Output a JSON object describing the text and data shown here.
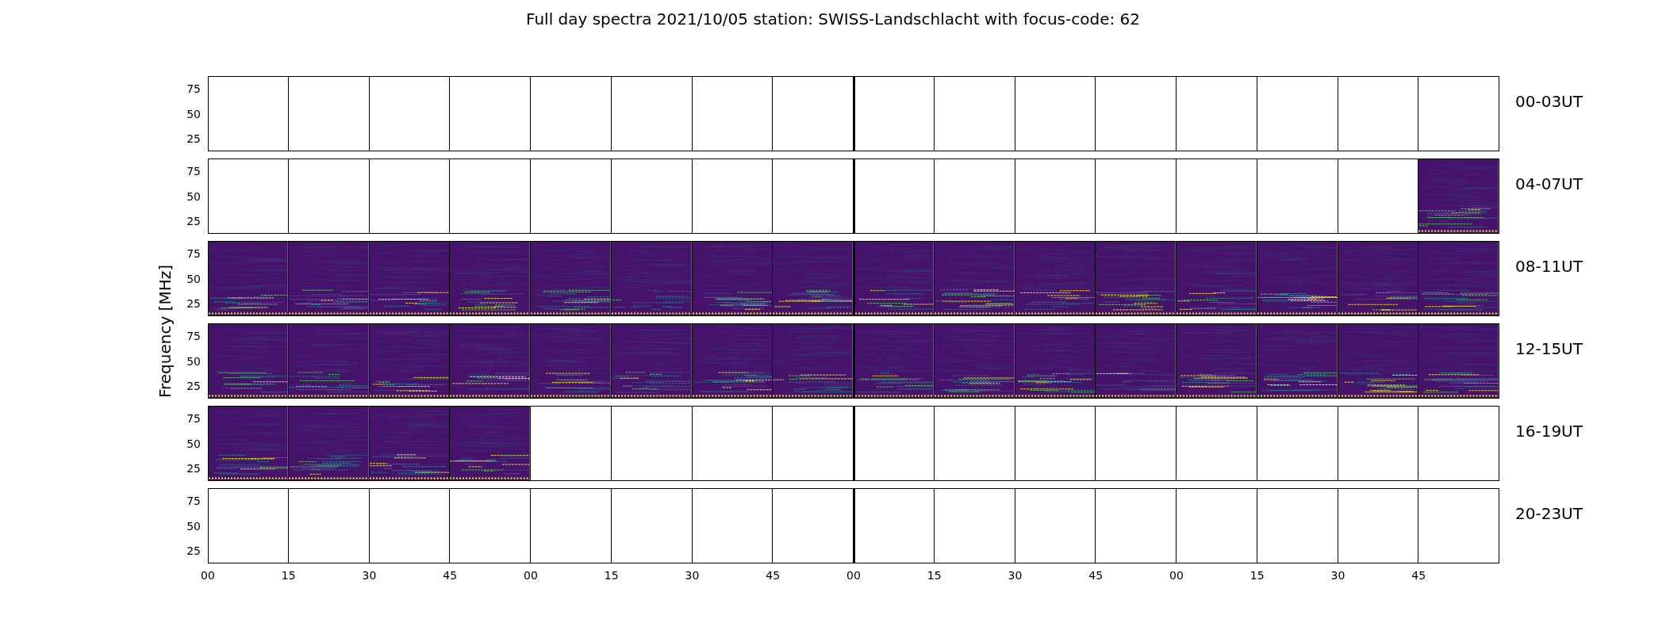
{
  "title": "Full day spectra 2021/10/05 station: SWISS-Landschlacht with focus-code: 62",
  "ylabel": "Frequency [MHz]",
  "rows": [
    {
      "label": "00-03UT",
      "yticks": [
        "75",
        "50",
        "25"
      ],
      "panels": [
        {
          "has_spectrum": false
        },
        {
          "has_spectrum": false
        },
        {
          "has_spectrum": false
        },
        {
          "has_spectrum": false
        },
        {
          "has_spectrum": false
        },
        {
          "has_spectrum": false
        },
        {
          "has_spectrum": false
        },
        {
          "has_spectrum": false
        },
        {
          "has_spectrum": false
        },
        {
          "has_spectrum": false
        },
        {
          "has_spectrum": false
        },
        {
          "has_spectrum": false
        },
        {
          "has_spectrum": false
        },
        {
          "has_spectrum": false
        },
        {
          "has_spectrum": false
        },
        {
          "has_spectrum": false
        }
      ]
    },
    {
      "label": "04-07UT",
      "yticks": [
        "75",
        "50",
        "25"
      ],
      "panels": [
        {
          "has_spectrum": false
        },
        {
          "has_spectrum": false
        },
        {
          "has_spectrum": false
        },
        {
          "has_spectrum": false
        },
        {
          "has_spectrum": false
        },
        {
          "has_spectrum": false
        },
        {
          "has_spectrum": false
        },
        {
          "has_spectrum": false
        },
        {
          "has_spectrum": false
        },
        {
          "has_spectrum": false
        },
        {
          "has_spectrum": false
        },
        {
          "has_spectrum": false
        },
        {
          "has_spectrum": false
        },
        {
          "has_spectrum": false
        },
        {
          "has_spectrum": false
        },
        {
          "has_spectrum": true
        }
      ]
    },
    {
      "label": "08-11UT",
      "yticks": [
        "75",
        "50",
        "25"
      ],
      "panels": [
        {
          "has_spectrum": true
        },
        {
          "has_spectrum": true
        },
        {
          "has_spectrum": true
        },
        {
          "has_spectrum": true
        },
        {
          "has_spectrum": true
        },
        {
          "has_spectrum": true
        },
        {
          "has_spectrum": true
        },
        {
          "has_spectrum": true
        },
        {
          "has_spectrum": true
        },
        {
          "has_spectrum": true
        },
        {
          "has_spectrum": true
        },
        {
          "has_spectrum": true
        },
        {
          "has_spectrum": true
        },
        {
          "has_spectrum": true
        },
        {
          "has_spectrum": true
        },
        {
          "has_spectrum": true
        }
      ]
    },
    {
      "label": "12-15UT",
      "yticks": [
        "75",
        "50",
        "25"
      ],
      "panels": [
        {
          "has_spectrum": true
        },
        {
          "has_spectrum": true
        },
        {
          "has_spectrum": true
        },
        {
          "has_spectrum": true
        },
        {
          "has_spectrum": true
        },
        {
          "has_spectrum": true
        },
        {
          "has_spectrum": true
        },
        {
          "has_spectrum": true
        },
        {
          "has_spectrum": true
        },
        {
          "has_spectrum": true
        },
        {
          "has_spectrum": true
        },
        {
          "has_spectrum": true
        },
        {
          "has_spectrum": true
        },
        {
          "has_spectrum": true
        },
        {
          "has_spectrum": true
        },
        {
          "has_spectrum": true
        }
      ]
    },
    {
      "label": "16-19UT",
      "yticks": [
        "75",
        "50",
        "25"
      ],
      "panels": [
        {
          "has_spectrum": true
        },
        {
          "has_spectrum": true
        },
        {
          "has_spectrum": true
        },
        {
          "has_spectrum": true
        },
        {
          "has_spectrum": false
        },
        {
          "has_spectrum": false
        },
        {
          "has_spectrum": false
        },
        {
          "has_spectrum": false
        },
        {
          "has_spectrum": false
        },
        {
          "has_spectrum": false
        },
        {
          "has_spectrum": false
        },
        {
          "has_spectrum": false
        },
        {
          "has_spectrum": false
        },
        {
          "has_spectrum": false
        },
        {
          "has_spectrum": false
        },
        {
          "has_spectrum": false
        }
      ]
    },
    {
      "label": "20-23UT",
      "yticks": [
        "75",
        "50",
        "25"
      ],
      "panels": [
        {
          "has_spectrum": false
        },
        {
          "has_spectrum": false
        },
        {
          "has_spectrum": false
        },
        {
          "has_spectrum": false
        },
        {
          "has_spectrum": false
        },
        {
          "has_spectrum": false
        },
        {
          "has_spectrum": false
        },
        {
          "has_spectrum": false
        },
        {
          "has_spectrum": false
        },
        {
          "has_spectrum": false
        },
        {
          "has_spectrum": false
        },
        {
          "has_spectrum": false
        },
        {
          "has_spectrum": false
        },
        {
          "has_spectrum": false
        },
        {
          "has_spectrum": false
        },
        {
          "has_spectrum": false
        }
      ]
    }
  ],
  "xticks": [
    "00",
    "15",
    "30",
    "45",
    "00",
    "15",
    "30",
    "45",
    "00",
    "15",
    "30",
    "45",
    "00",
    "15",
    "30",
    "45"
  ]
}
